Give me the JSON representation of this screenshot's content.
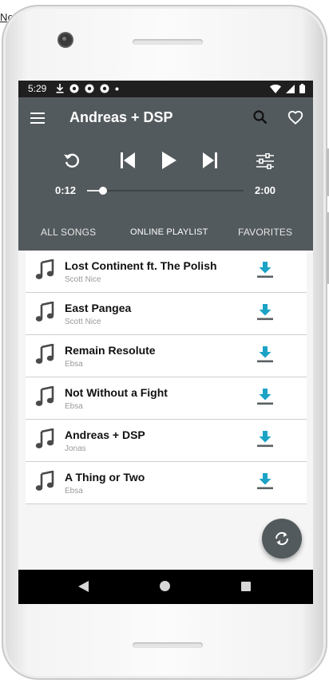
{
  "background": {
    "text": "Noi"
  },
  "status_bar": {
    "time": "5:29"
  },
  "app_bar": {
    "title": "Andreas + DSP"
  },
  "player": {
    "current_time": "0:12",
    "total_time": "2:00",
    "progress": 0.1
  },
  "tabs": [
    {
      "label": "ALL SONGS"
    },
    {
      "label": "ONLINE PLAYLIST"
    },
    {
      "label": "FAVORITES"
    }
  ],
  "songs": [
    {
      "title": "Lost Continent ft. The Polish",
      "artist": "Scott Nice"
    },
    {
      "title": "East Pangea",
      "artist": "Scott Nice"
    },
    {
      "title": "Remain Resolute",
      "artist": "Ebsa"
    },
    {
      "title": "Not Without a Fight",
      "artist": "Ebsa"
    },
    {
      "title": "Andreas + DSP",
      "artist": "Jonas"
    },
    {
      "title": "A Thing or Two",
      "artist": "Ebsa"
    }
  ],
  "icons": {
    "menu": "menu-icon",
    "search": "search-icon",
    "favorite": "heart-icon",
    "replay": "replay-icon",
    "previous": "skip-previous-icon",
    "play": "play-icon",
    "next": "skip-next-icon",
    "equalizer": "equalizer-icon",
    "song": "music-note-icon",
    "download": "download-icon",
    "sync": "sync-icon"
  },
  "colors": {
    "player_bg": "#535a5d",
    "download": "#1ba3c6",
    "status_bar": "#1f1f1f"
  }
}
